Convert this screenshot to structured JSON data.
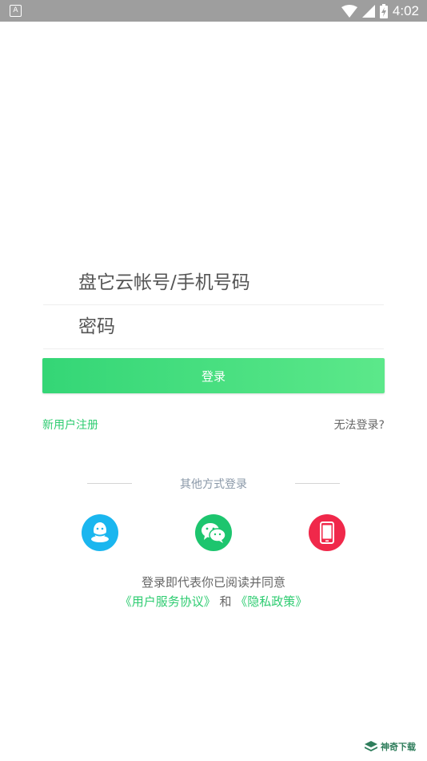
{
  "status_bar": {
    "time": "4:02",
    "notification_icon": "a-icon"
  },
  "form": {
    "account_placeholder": "盘它云帐号/手机号码",
    "password_placeholder": "密码",
    "login_label": "登录"
  },
  "links": {
    "register": "新用户注册",
    "cannot_login": "无法登录?"
  },
  "other_login": {
    "title": "其他方式登录",
    "methods": [
      {
        "icon": "qq-icon",
        "color": "#1ab6ef"
      },
      {
        "icon": "wechat-icon",
        "color": "#1dc56e"
      },
      {
        "icon": "phone-icon",
        "color": "#f0284a"
      }
    ]
  },
  "agreement": {
    "line1": "登录即代表你已阅读并同意",
    "user_agreement": "《用户服务协议》",
    "and": "和",
    "privacy_policy": "《隐私政策》"
  },
  "watermark": {
    "text": "神奇下载"
  },
  "colors": {
    "accent": "#2ecc71",
    "status_bar": "#9e9e9e"
  }
}
